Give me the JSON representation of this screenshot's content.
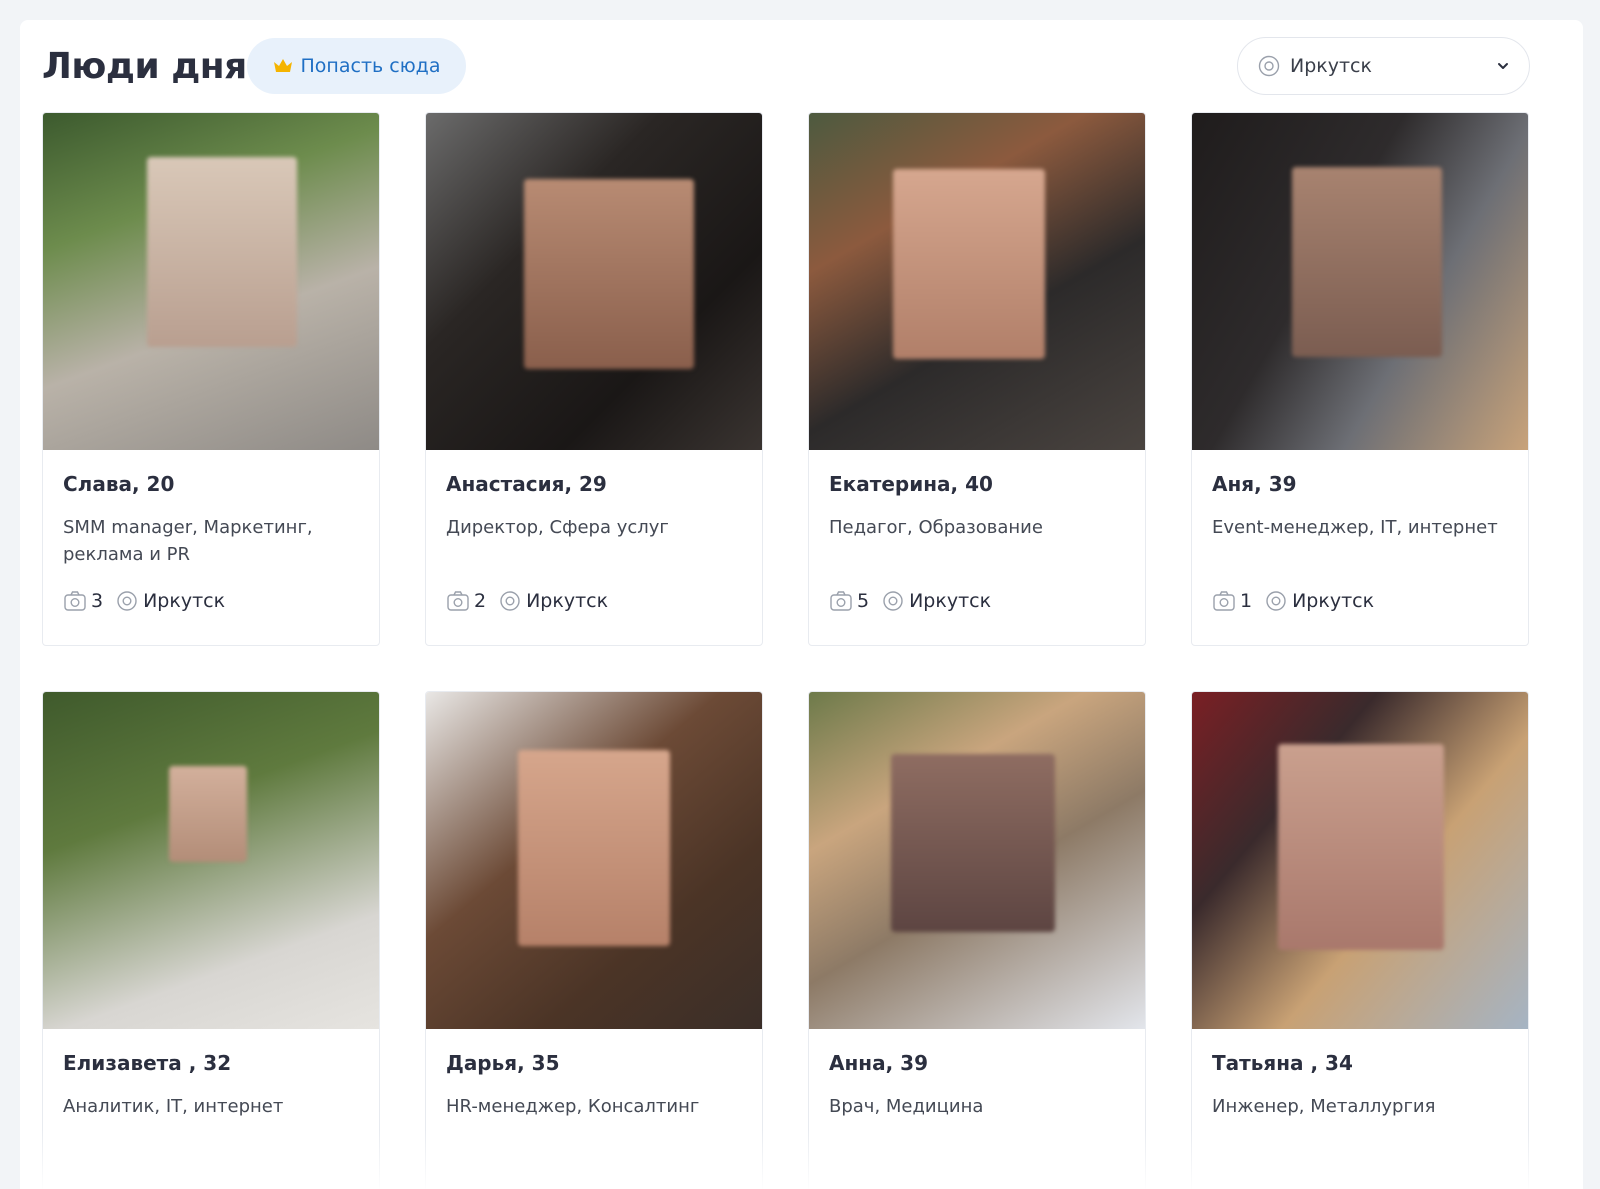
{
  "header": {
    "title": "Люди дня",
    "promo_label": "Попасть сюда",
    "city_value": "Иркутск"
  },
  "colors": {
    "accent": "#1f6fc4",
    "promo_bg": "#e8f1fb",
    "crown": "#f5b400"
  },
  "icons": {
    "promo": "crown-icon",
    "location": "location-pin-icon",
    "dropdown": "chevron-down-icon",
    "photos": "camera-icon"
  },
  "cards": [
    {
      "name": "Слава, 20",
      "job": "SMM manager, Маркетинг, реклама и PR",
      "photos": "3",
      "city": "Иркутск"
    },
    {
      "name": "Анастасия, 29",
      "job": "Директор, Сфера услуг",
      "photos": "2",
      "city": "Иркутск"
    },
    {
      "name": "Екатерина, 40",
      "job": "Педагог, Образование",
      "photos": "5",
      "city": "Иркутск"
    },
    {
      "name": "Аня, 39",
      "job": "Event-менеджер, IT, интернет",
      "photos": "1",
      "city": "Иркутск"
    },
    {
      "name": "Елизавета , 32",
      "job": "Аналитик, IT, интернет"
    },
    {
      "name": "Дарья, 35",
      "job": "HR-менеджер, Консалтинг"
    },
    {
      "name": "Анна, 39",
      "job": "Врач, Медицина"
    },
    {
      "name": "Татьяна , 34",
      "job": "Инженер, Металлургия"
    }
  ]
}
